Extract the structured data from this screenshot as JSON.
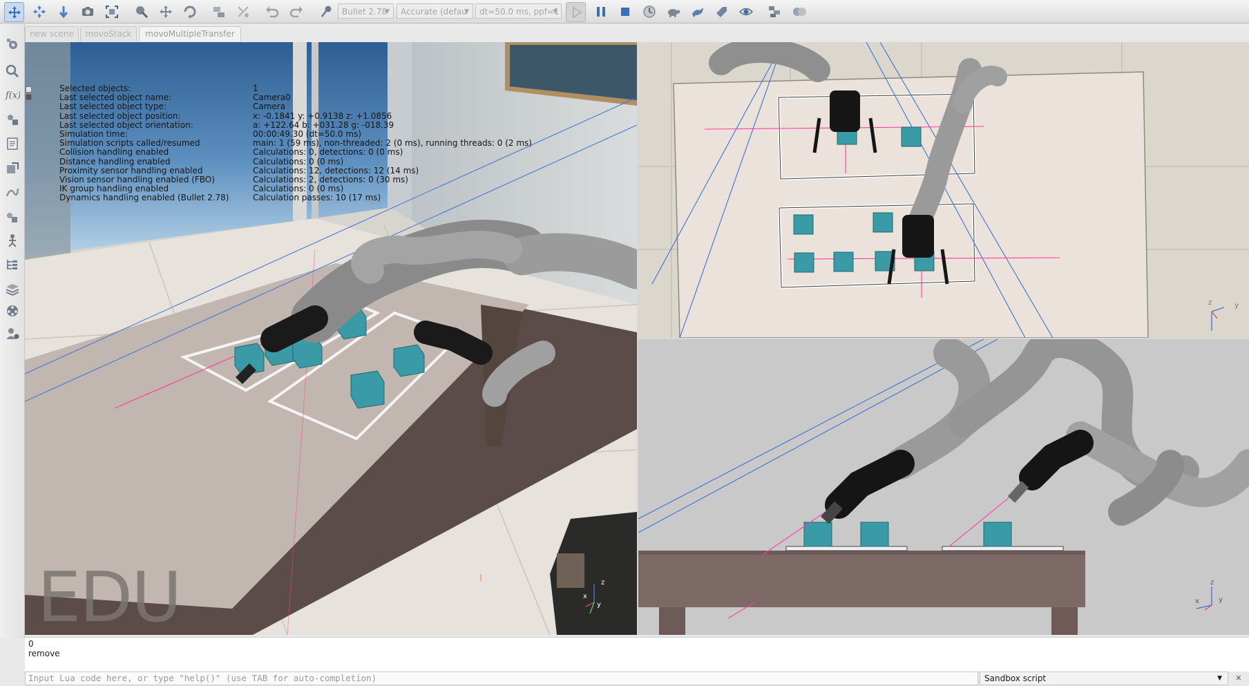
{
  "toolbar": {
    "engine": "Bullet 2.78",
    "accuracy": "Accurate (defau",
    "timestep": "dt=50.0 ms, ppf=1"
  },
  "tabs": [
    {
      "label": "new scene"
    },
    {
      "label": "movoStack"
    },
    {
      "label": "movoMultipleTransfer"
    }
  ],
  "info": {
    "rows": [
      {
        "label": "Selected objects:",
        "value": "1"
      },
      {
        "label": "Last selected object name:",
        "value": "Camera0"
      },
      {
        "label": "Last selected object type:",
        "value": "Camera"
      },
      {
        "label": "Last selected object position:",
        "value": "x: -0.1841    y: +0.9138    z: +1.0856"
      },
      {
        "label": "Last selected object orientation:",
        "value": "a: +122.64    b: +031.28    g: -018.39"
      },
      {
        "label": "Simulation time:",
        "value": "00:00:49.30 (dt=50.0 ms)"
      },
      {
        "label": "Simulation scripts called/resumed",
        "value": "main: 1 (59 ms), non-threaded: 2 (0 ms), running threads: 0 (2 ms)"
      },
      {
        "label": "Collision handling enabled",
        "value": "Calculations: 0, detections: 0 (0 ms)"
      },
      {
        "label": "Distance handling enabled",
        "value": "Calculations: 0 (0 ms)"
      },
      {
        "label": "Proximity sensor handling enabled",
        "value": "Calculations: 12, detections: 12 (14 ms)"
      },
      {
        "label": "Vision sensor handling enabled (FBO)",
        "value": "Calculations: 2, detections: 0 (30 ms)"
      },
      {
        "label": "IK group handling enabled",
        "value": "Calculations: 0 (0 ms)"
      },
      {
        "label": "Dynamics handling enabled (Bullet 2.78)",
        "value": "Calculation passes: 10 (17 ms)"
      }
    ]
  },
  "watermark": "EDU",
  "axes": {
    "x": "x",
    "y": "y",
    "z": "z"
  },
  "console": {
    "lines": [
      "0",
      "remove"
    ],
    "input_placeholder": "Input Lua code here, or type \"help()\" (use TAB for auto-completion)",
    "script_selector": "Sandbox script"
  },
  "colors": {
    "cube": "#3a9aa5",
    "robot_arm": "#8a8a8a",
    "gripper": "#151515",
    "table_top": "#c4b9b3",
    "table_legs": "#5e4e4b",
    "sensor_line": "#ff3ea0",
    "frustum_line": "#3a72d8"
  }
}
